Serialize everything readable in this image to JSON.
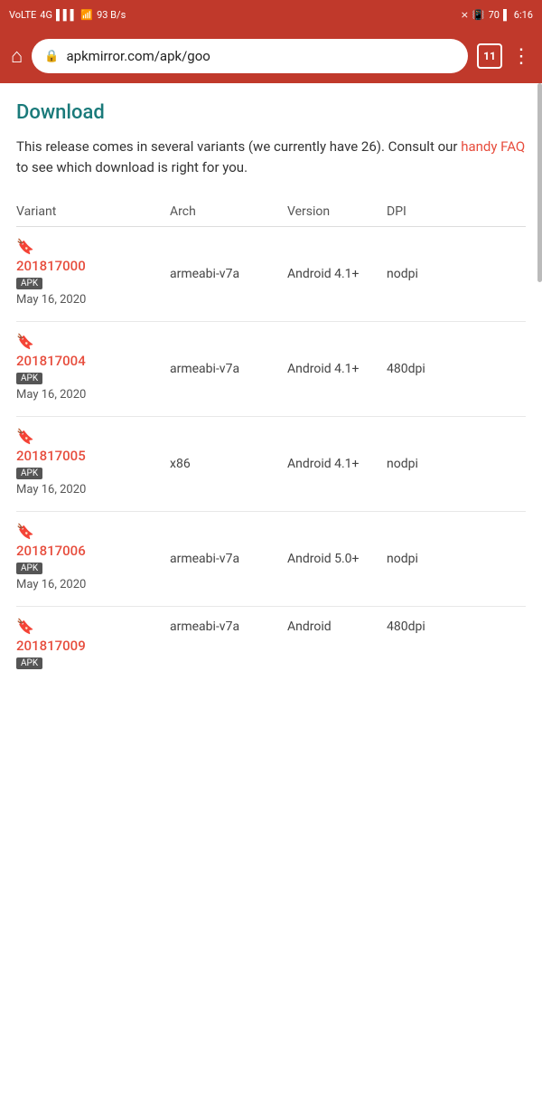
{
  "status_bar": {
    "carrier": "VoLTE",
    "signal": "4G",
    "wifi": "WiFi",
    "data_speed": "93 B/s",
    "bluetooth": "BT",
    "battery": "70",
    "time": "6:16"
  },
  "browser": {
    "url": "apkmirror.com/apk/goo",
    "tab_count": "11",
    "home_icon": "⌂",
    "lock_icon": "🔒",
    "more_icon": "⋮"
  },
  "page": {
    "section_title": "Download",
    "intro": "This release comes in several variants (we currently have 26). Consult our ",
    "link_text": "handy FAQ",
    "intro_end": " to see which download is right for you.",
    "table": {
      "headers": [
        "Variant",
        "Arch",
        "Version",
        "DPI"
      ],
      "rows": [
        {
          "number": "201817000",
          "badge": "APK",
          "date": "May 16, 2020",
          "arch": "armeabi-v7a",
          "version": "Android 4.1+",
          "dpi": "nodpi"
        },
        {
          "number": "201817004",
          "badge": "APK",
          "date": "May 16, 2020",
          "arch": "armeabi-v7a",
          "version": "Android 4.1+",
          "dpi": "480dpi"
        },
        {
          "number": "201817005",
          "badge": "APK",
          "date": "May 16, 2020",
          "arch": "x86",
          "version": "Android 4.1+",
          "dpi": "nodpi"
        },
        {
          "number": "201817006",
          "badge": "APK",
          "date": "May 16, 2020",
          "arch": "armeabi-v7a",
          "version": "Android 5.0+",
          "dpi": "nodpi"
        },
        {
          "number": "201817009",
          "badge": "APK",
          "date": "",
          "arch": "armeabi-v7a",
          "version": "Android",
          "dpi": "480dpi"
        }
      ]
    }
  }
}
